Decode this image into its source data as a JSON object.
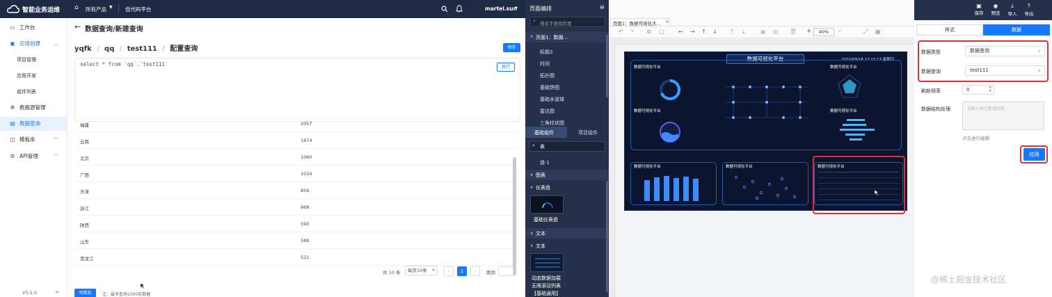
{
  "topbar": {
    "app_title": "智能业务运维",
    "nav_products": "所有产品",
    "nav_lowcode": "低代码平台",
    "user": "martel.sun"
  },
  "sidebar": {
    "items": [
      {
        "label": "工作台",
        "icon": "desktop-icon"
      },
      {
        "label": "应用创建",
        "icon": "app-icon"
      },
      {
        "label": "项目管理"
      },
      {
        "label": "应用开发"
      },
      {
        "label": "组件列表"
      },
      {
        "label": "数据源管理",
        "icon": "gear-icon"
      },
      {
        "label": "数据查询",
        "icon": "file-icon"
      },
      {
        "label": "模板库",
        "icon": "template-icon"
      },
      {
        "label": "API管理",
        "icon": "api-icon"
      }
    ],
    "version": "V5.5.0"
  },
  "query": {
    "page_title": "数据查询/新建查询",
    "breadcrumb": [
      "yqfk",
      "qq",
      "test111",
      "配置查询"
    ],
    "save_label": "保存",
    "sql": "select * from `qq`.`test111`",
    "run_label": "执行"
  },
  "result_table": {
    "rows": [
      [
        "福建",
        "2057"
      ],
      [
        "云南",
        "1674"
      ],
      [
        "北京",
        "1060"
      ],
      [
        "广西",
        "1034"
      ],
      [
        "天津",
        "856"
      ],
      [
        "浙江",
        "668"
      ],
      [
        "陕西",
        "593"
      ],
      [
        "山东",
        "588"
      ],
      [
        "黑龙江",
        "521"
      ]
    ]
  },
  "pagination": {
    "total": "共 10 条",
    "per_page": "每页10条",
    "current": "1",
    "jump": "跳到"
  },
  "footer": {
    "visualize_label": "可视化",
    "note": "注：最多查询1000条数据"
  },
  "page_editor": {
    "title": "页面编排",
    "search_placeholder": "搜名字查找页面",
    "page_node": "页面1：数据...",
    "tree_items": [
      "标题3",
      "时间",
      "拓扑图",
      "基础饼图",
      "基础水波球",
      "雷达图",
      "三角柱状图"
    ],
    "tabs": [
      "基础组件",
      "项目组件"
    ],
    "component_search": "表",
    "items": {
      "pie_item": "盘-1",
      "section_chart": "图表",
      "group_gauge": "仪表盘",
      "gauge_item": "基础仪表盘",
      "section_text": "文本",
      "group_text": "文本",
      "scroll_item_1": "动态数据加载",
      "scroll_item_2": "无限滚动列表",
      "scroll_item_3": "【基础通用】"
    }
  },
  "workspace": {
    "tab_label": "页面1：数据可视化大...",
    "zoom": "40%",
    "dashboard_title": "数据可视化平台",
    "dashboard_time": "2022/09/18 17:22:13 星期日",
    "panel_title": "数据可视化平台"
  },
  "properties": {
    "top_buttons": [
      "保存",
      "预览",
      "导入",
      "导出"
    ],
    "tabs": [
      "样式",
      "数据"
    ],
    "data_type_label": "数据类型",
    "data_type_value": "数据查询",
    "data_query_label": "数据查询",
    "data_query_value": "test111",
    "refresh_label": "刷新频率",
    "refresh_value": "0",
    "struct_label": "数据结构处理",
    "struct_placeholder": "请输入格式数据函数",
    "edit_hint": "点击进行编辑",
    "apply_label": "应用"
  },
  "watermark": "@稀土掘金技术社区",
  "colors": {
    "accent": "#1677ff",
    "dark_nav": "#1f2a44",
    "editor_nav": "#25304a",
    "highlight": "#e03131"
  }
}
